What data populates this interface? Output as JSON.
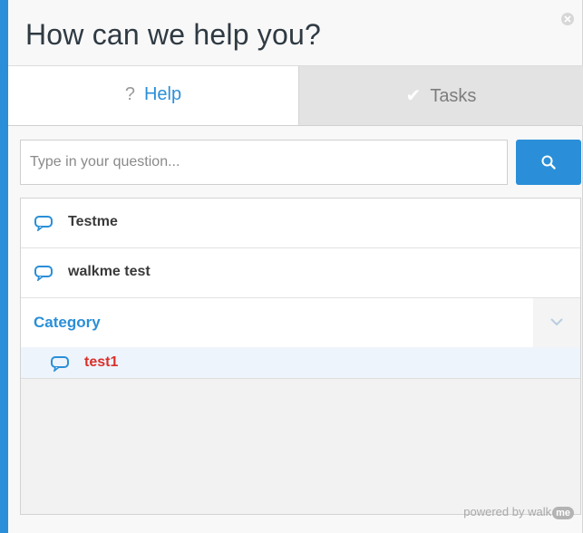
{
  "header": {
    "title": "How can we help you?"
  },
  "tabs": [
    {
      "label": "Help",
      "icon": "question-icon",
      "glyph": "?",
      "active": true
    },
    {
      "label": "Tasks",
      "icon": "check-icon",
      "glyph": "✔",
      "active": false
    }
  ],
  "search": {
    "placeholder": "Type in your question...",
    "value": "",
    "button_icon": "search-icon"
  },
  "items": [
    {
      "label": "Testme",
      "icon": "chat-bubble-icon"
    },
    {
      "label": "walkme test",
      "icon": "chat-bubble-icon"
    }
  ],
  "category": {
    "label": "Category",
    "toggle_icon": "chevron-down-icon",
    "items": [
      {
        "label": "test1",
        "icon": "chat-bubble-icon"
      }
    ]
  },
  "footer": {
    "powered_by": "powered by walk",
    "badge": "me"
  },
  "colors": {
    "accent": "#2a8fd8",
    "highlight_text": "#d9302b"
  }
}
